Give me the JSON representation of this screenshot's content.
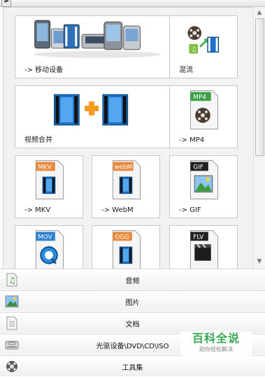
{
  "tiles": {
    "mobile": "-> 移动设备",
    "mux": "混流",
    "merge": "视频合并",
    "mp4": "-> MP4",
    "mkv": "-> MKV",
    "webm": "-> WebM",
    "gif": "-> GIF"
  },
  "file_tags": {
    "mp4": "MP4",
    "mkv": "MKV",
    "webm": "webM",
    "gif": "GIF",
    "mov": "MOV",
    "ogg": "OGG",
    "flv": "FLV"
  },
  "categories": {
    "audio": "音频",
    "picture": "图片",
    "document": "文档",
    "rom": "光驱设备\\DVD\\CD\\ISO",
    "tools": "工具集"
  },
  "watermark": {
    "title": "百科全说",
    "subtitle": "助你轻松解决"
  },
  "colors": {
    "tile_border": "#c8c8c8",
    "panel_bg": "#f2f2f2",
    "film_blue": "#1a73c9",
    "plus_orange": "#f39a1f",
    "watermark_green": "#34a853"
  }
}
